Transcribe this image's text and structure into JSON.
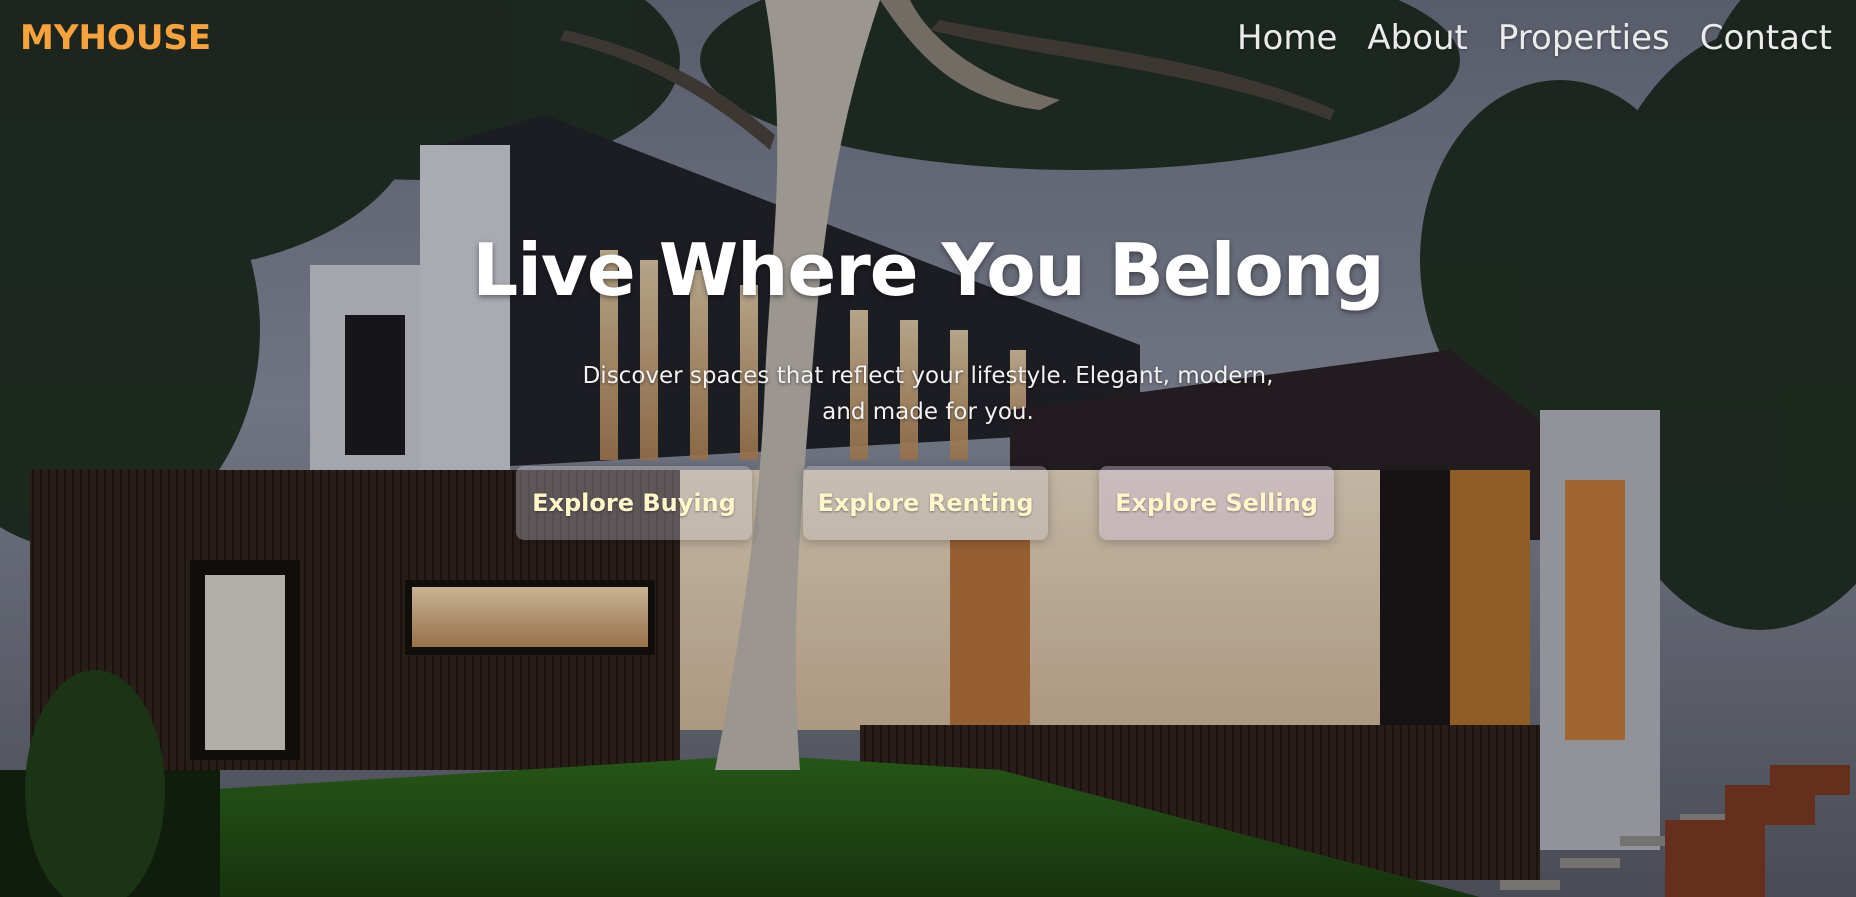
{
  "header": {
    "logo": "MYHOUSE",
    "nav": [
      {
        "label": "Home"
      },
      {
        "label": "About"
      },
      {
        "label": "Properties"
      },
      {
        "label": "Contact"
      }
    ]
  },
  "hero": {
    "title": "Live Where You Belong",
    "subtitle": "Discover spaces that reflect your lifestyle. Elegant, modern, and made for you.",
    "buttons": [
      {
        "label": "Explore Buying"
      },
      {
        "label": "Explore Renting"
      },
      {
        "label": "Explore Selling"
      }
    ]
  },
  "colors": {
    "logo": "#f7a23b",
    "nav_text": "#ebebeb",
    "button_text": "#fff6c9"
  }
}
